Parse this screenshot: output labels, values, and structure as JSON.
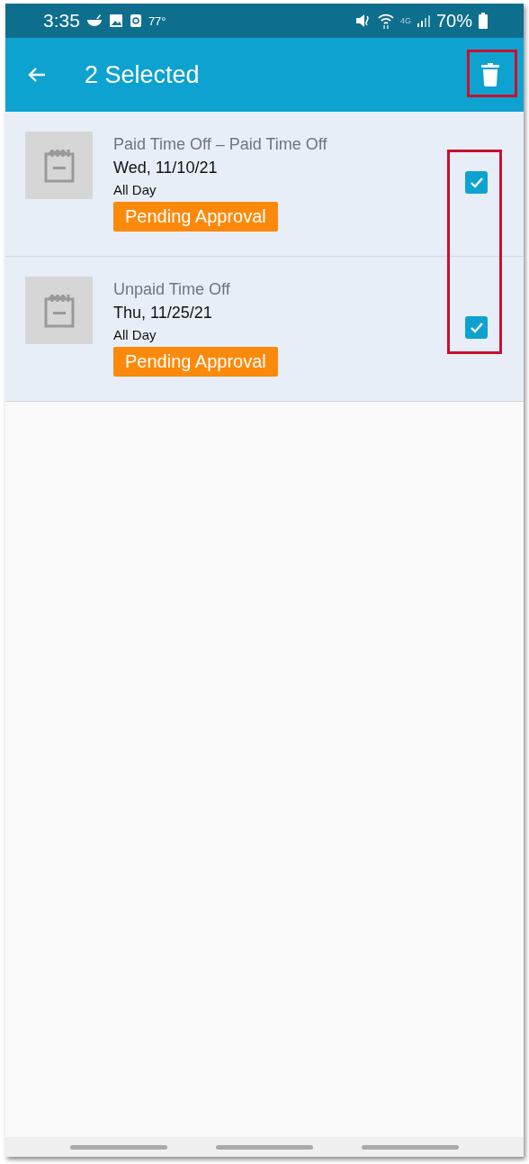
{
  "status_bar": {
    "time": "3:35",
    "temperature": "77°",
    "network": "4G",
    "battery": "70%"
  },
  "app_bar": {
    "title": "2 Selected"
  },
  "items": [
    {
      "type": "Paid Time Off – Paid Time Off",
      "date": "Wed, 11/10/21",
      "duration": "All Day",
      "status": "Pending Approval",
      "selected": true
    },
    {
      "type": "Unpaid Time Off",
      "date": "Thu, 11/25/21",
      "duration": "All Day",
      "status": "Pending Approval",
      "selected": true
    }
  ]
}
